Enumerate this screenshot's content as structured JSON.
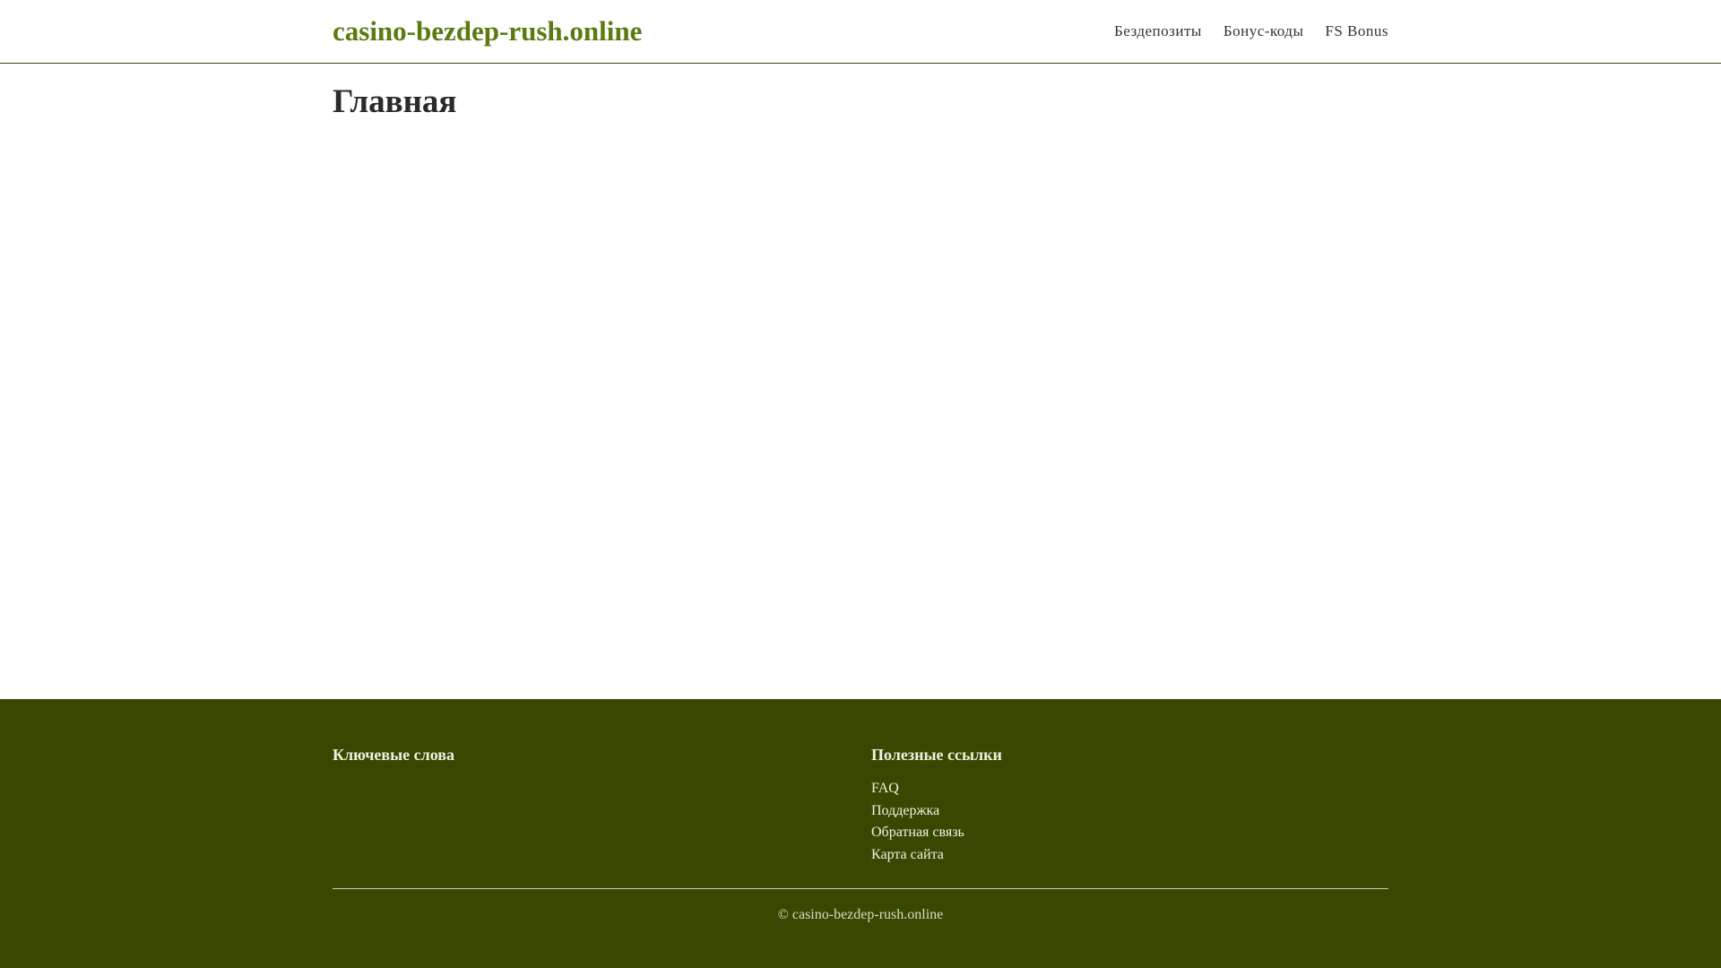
{
  "header": {
    "brand": "casino-bezdep-rush.online",
    "nav": [
      {
        "label": "Бездепозиты"
      },
      {
        "label": "Бонус-коды"
      },
      {
        "label": "FS Bonus"
      }
    ]
  },
  "main": {
    "title": "Главная"
  },
  "footer": {
    "keywords_title": "Ключевые слова",
    "links_title": "Полезные ссылки",
    "links": [
      {
        "label": "FAQ"
      },
      {
        "label": "Поддержка"
      },
      {
        "label": "Обратная связь"
      },
      {
        "label": "Карта сайта"
      }
    ],
    "copyright": "© casino-bezdep-rush.online"
  },
  "colors": {
    "brand": "#5b7a0f",
    "footer_bg": "#394800"
  }
}
